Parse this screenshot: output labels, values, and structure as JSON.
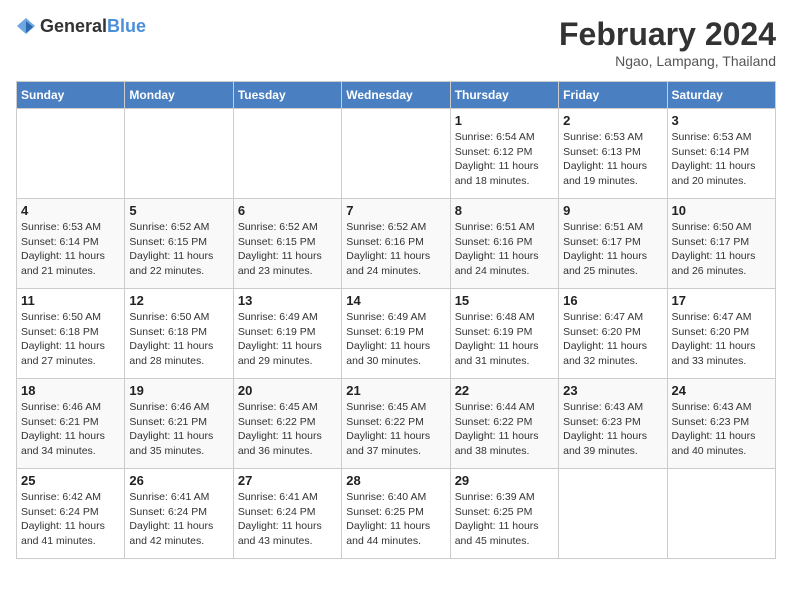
{
  "header": {
    "logo_general": "General",
    "logo_blue": "Blue",
    "month_title": "February 2024",
    "location": "Ngao, Lampang, Thailand"
  },
  "weekdays": [
    "Sunday",
    "Monday",
    "Tuesday",
    "Wednesday",
    "Thursday",
    "Friday",
    "Saturday"
  ],
  "weeks": [
    [
      {
        "day": "",
        "info": ""
      },
      {
        "day": "",
        "info": ""
      },
      {
        "day": "",
        "info": ""
      },
      {
        "day": "",
        "info": ""
      },
      {
        "day": "1",
        "info": "Sunrise: 6:54 AM\nSunset: 6:12 PM\nDaylight: 11 hours\nand 18 minutes."
      },
      {
        "day": "2",
        "info": "Sunrise: 6:53 AM\nSunset: 6:13 PM\nDaylight: 11 hours\nand 19 minutes."
      },
      {
        "day": "3",
        "info": "Sunrise: 6:53 AM\nSunset: 6:14 PM\nDaylight: 11 hours\nand 20 minutes."
      }
    ],
    [
      {
        "day": "4",
        "info": "Sunrise: 6:53 AM\nSunset: 6:14 PM\nDaylight: 11 hours\nand 21 minutes."
      },
      {
        "day": "5",
        "info": "Sunrise: 6:52 AM\nSunset: 6:15 PM\nDaylight: 11 hours\nand 22 minutes."
      },
      {
        "day": "6",
        "info": "Sunrise: 6:52 AM\nSunset: 6:15 PM\nDaylight: 11 hours\nand 23 minutes."
      },
      {
        "day": "7",
        "info": "Sunrise: 6:52 AM\nSunset: 6:16 PM\nDaylight: 11 hours\nand 24 minutes."
      },
      {
        "day": "8",
        "info": "Sunrise: 6:51 AM\nSunset: 6:16 PM\nDaylight: 11 hours\nand 24 minutes."
      },
      {
        "day": "9",
        "info": "Sunrise: 6:51 AM\nSunset: 6:17 PM\nDaylight: 11 hours\nand 25 minutes."
      },
      {
        "day": "10",
        "info": "Sunrise: 6:50 AM\nSunset: 6:17 PM\nDaylight: 11 hours\nand 26 minutes."
      }
    ],
    [
      {
        "day": "11",
        "info": "Sunrise: 6:50 AM\nSunset: 6:18 PM\nDaylight: 11 hours\nand 27 minutes."
      },
      {
        "day": "12",
        "info": "Sunrise: 6:50 AM\nSunset: 6:18 PM\nDaylight: 11 hours\nand 28 minutes."
      },
      {
        "day": "13",
        "info": "Sunrise: 6:49 AM\nSunset: 6:19 PM\nDaylight: 11 hours\nand 29 minutes."
      },
      {
        "day": "14",
        "info": "Sunrise: 6:49 AM\nSunset: 6:19 PM\nDaylight: 11 hours\nand 30 minutes."
      },
      {
        "day": "15",
        "info": "Sunrise: 6:48 AM\nSunset: 6:19 PM\nDaylight: 11 hours\nand 31 minutes."
      },
      {
        "day": "16",
        "info": "Sunrise: 6:47 AM\nSunset: 6:20 PM\nDaylight: 11 hours\nand 32 minutes."
      },
      {
        "day": "17",
        "info": "Sunrise: 6:47 AM\nSunset: 6:20 PM\nDaylight: 11 hours\nand 33 minutes."
      }
    ],
    [
      {
        "day": "18",
        "info": "Sunrise: 6:46 AM\nSunset: 6:21 PM\nDaylight: 11 hours\nand 34 minutes."
      },
      {
        "day": "19",
        "info": "Sunrise: 6:46 AM\nSunset: 6:21 PM\nDaylight: 11 hours\nand 35 minutes."
      },
      {
        "day": "20",
        "info": "Sunrise: 6:45 AM\nSunset: 6:22 PM\nDaylight: 11 hours\nand 36 minutes."
      },
      {
        "day": "21",
        "info": "Sunrise: 6:45 AM\nSunset: 6:22 PM\nDaylight: 11 hours\nand 37 minutes."
      },
      {
        "day": "22",
        "info": "Sunrise: 6:44 AM\nSunset: 6:22 PM\nDaylight: 11 hours\nand 38 minutes."
      },
      {
        "day": "23",
        "info": "Sunrise: 6:43 AM\nSunset: 6:23 PM\nDaylight: 11 hours\nand 39 minutes."
      },
      {
        "day": "24",
        "info": "Sunrise: 6:43 AM\nSunset: 6:23 PM\nDaylight: 11 hours\nand 40 minutes."
      }
    ],
    [
      {
        "day": "25",
        "info": "Sunrise: 6:42 AM\nSunset: 6:24 PM\nDaylight: 11 hours\nand 41 minutes."
      },
      {
        "day": "26",
        "info": "Sunrise: 6:41 AM\nSunset: 6:24 PM\nDaylight: 11 hours\nand 42 minutes."
      },
      {
        "day": "27",
        "info": "Sunrise: 6:41 AM\nSunset: 6:24 PM\nDaylight: 11 hours\nand 43 minutes."
      },
      {
        "day": "28",
        "info": "Sunrise: 6:40 AM\nSunset: 6:25 PM\nDaylight: 11 hours\nand 44 minutes."
      },
      {
        "day": "29",
        "info": "Sunrise: 6:39 AM\nSunset: 6:25 PM\nDaylight: 11 hours\nand 45 minutes."
      },
      {
        "day": "",
        "info": ""
      },
      {
        "day": "",
        "info": ""
      }
    ]
  ]
}
